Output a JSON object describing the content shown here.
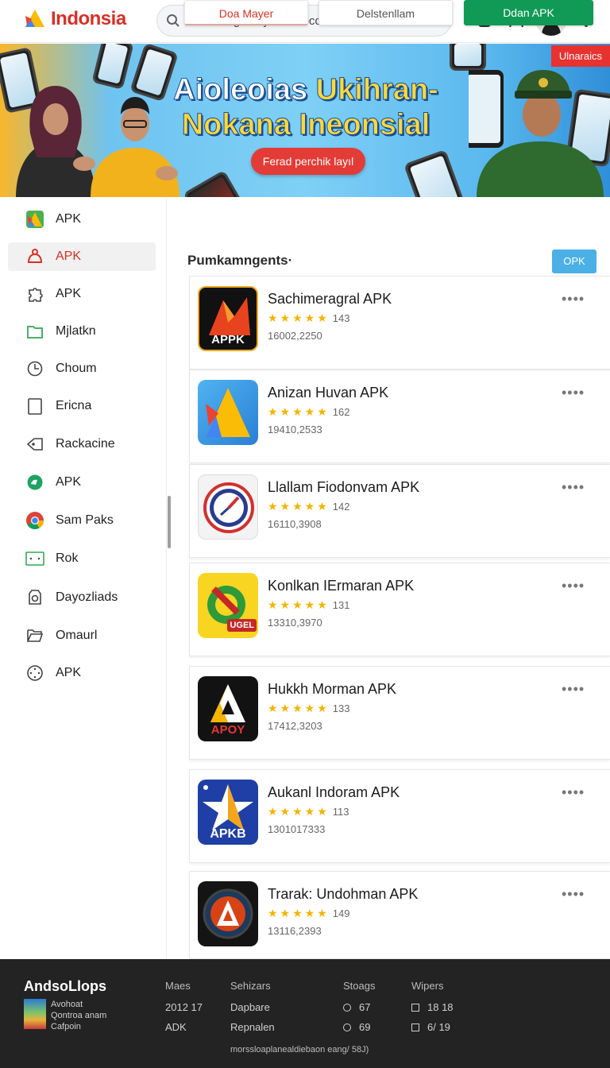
{
  "header": {
    "brand": "Indonsia",
    "search_value": "sstdhrlalgınaayatmanocorann"
  },
  "banner": {
    "tag": "Ulnaraics",
    "title_line1_a": "Aioleoias ",
    "title_line1_b": "Ukihran-",
    "title_line2": "Nokana Ineonsial",
    "cta": "Ferad perchik layıl"
  },
  "sidebar": {
    "items": [
      {
        "label": "APK",
        "icon": "triangle-logo-icon"
      },
      {
        "label": "APK",
        "icon": "android-icon"
      },
      {
        "label": "APK",
        "icon": "puzzle-icon"
      },
      {
        "label": "Mjlatkn",
        "icon": "folder-icon"
      },
      {
        "label": "Choum",
        "icon": "clock-icon"
      },
      {
        "label": "Ericna",
        "icon": "tablet-icon"
      },
      {
        "label": "Rackacine",
        "icon": "tag-icon"
      },
      {
        "label": "APK",
        "icon": "chat-bubble-icon"
      },
      {
        "label": "Sam Paks",
        "icon": "chrome-icon"
      },
      {
        "label": "Rok",
        "icon": "window-icon"
      },
      {
        "label": "Dayozliads",
        "icon": "camera-icon"
      },
      {
        "label": "Omaurl",
        "icon": "folder-open-icon"
      },
      {
        "label": "APK",
        "icon": "gamepad-icon"
      }
    ]
  },
  "tabs": {
    "tab1": "Doa Mayer",
    "tab2": "Delstenllam",
    "tab3": "Ddan APK"
  },
  "section": {
    "title": "Pumkamngents·",
    "button": "OPK"
  },
  "apps": [
    {
      "name": "Sachimeragral APK",
      "rating": "143",
      "meta": "16002,2250",
      "stars": "★★★★★",
      "icon_text": "APPK"
    },
    {
      "name": "Anizan Huvan APK",
      "rating": "162",
      "meta": "19410,2533",
      "stars": "★★★★★",
      "icon_text": ""
    },
    {
      "name": "Llallam Fiodonvam APK",
      "rating": "142",
      "meta": "16110,3908",
      "stars": "★★★★★",
      "icon_text": ""
    },
    {
      "name": "Konlkan IErmaran APK",
      "rating": "131",
      "meta": "13310,3970",
      "stars": "★★★★★",
      "icon_text": "UGEL"
    },
    {
      "name": "Hukkh Morman APK",
      "rating": "133",
      "meta": "17412,3203",
      "stars": "★★★★★",
      "icon_text": "APOY"
    },
    {
      "name": "Aukanl Indoram APK",
      "rating": "113",
      "meta": "1301017333",
      "stars": "★★★★★",
      "icon_text": "APKB"
    },
    {
      "name": "Trarak: Undohman APK",
      "rating": "149",
      "meta": "13116,2393",
      "stars": "★★★★★",
      "icon_text": ""
    }
  ],
  "footer": {
    "brand": "AndsoLlops",
    "brand_sub1": "Avohoat",
    "brand_sub2": "Qontroa anam",
    "brand_sub3": "Cafpoin",
    "col1_head": "Maes",
    "col1_r1": "2012 17",
    "col1_r2": "ADK",
    "col2_head": "Sehizars",
    "col2_r1": "Dapbare",
    "col2_r2": "Repnalen",
    "col3_head": "Stoags",
    "col3_r1": "67",
    "col3_r2": "69",
    "col4_head": "Wipers",
    "col4_r1": "18 18",
    "col4_r2": "6/ 19",
    "bottom": "morssloaplanealdiebaon eang/ 58J)"
  },
  "colors": {
    "brand_red": "#d93025",
    "green": "#109a56",
    "blue": "#4ab0e6",
    "star": "#f4b400"
  }
}
